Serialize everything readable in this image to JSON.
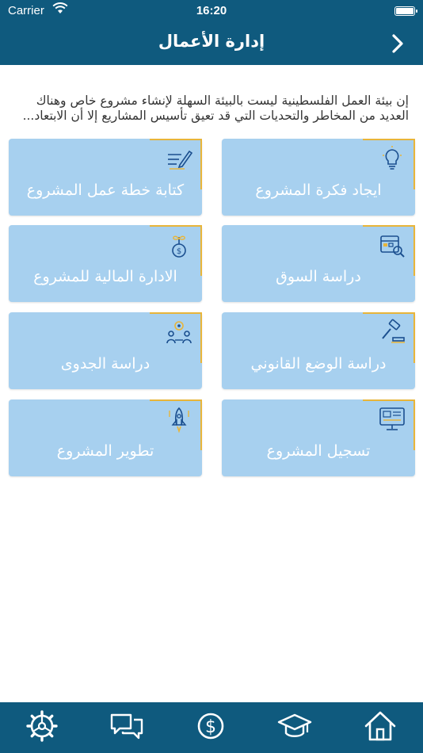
{
  "status_bar": {
    "carrier": "Carrier",
    "time": "16:20",
    "wifi_icon": "wifi-icon",
    "battery_icon": "battery-icon"
  },
  "nav": {
    "title": "إدارة الأعمال",
    "back_icon": "chevron-right-icon"
  },
  "intro_text": "إن بيئة العمل الفلسطينية ليست بالبيئة السهلة لإنشاء مشروع خاص وهناك العديد من المخاطر والتحديات التي قد تعيق تأسيس المشاريع إلا أن الابتعاد...",
  "cards": [
    {
      "label": "ايجاد فكرة المشروع",
      "icon": "lightbulb-icon"
    },
    {
      "label": "كتابة خطة عمل المشروع",
      "icon": "writing-icon"
    },
    {
      "label": "دراسة السوق",
      "icon": "market-analysis-icon"
    },
    {
      "label": "الادارة المالية للمشروع",
      "icon": "money-plant-icon"
    },
    {
      "label": "دراسة الوضع القانوني",
      "icon": "gavel-icon"
    },
    {
      "label": "دراسة الجدوى",
      "icon": "feasibility-team-icon"
    },
    {
      "label": "تسجيل المشروع",
      "icon": "registration-monitor-icon"
    },
    {
      "label": "تطوير المشروع",
      "icon": "rocket-icon"
    }
  ],
  "tab_bar": [
    {
      "icon": "settings-icon"
    },
    {
      "icon": "chat-icon"
    },
    {
      "icon": "dollar-icon"
    },
    {
      "icon": "graduation-cap-icon"
    },
    {
      "icon": "home-icon"
    }
  ],
  "colors": {
    "primary": "#0f5a7e",
    "card": "#a7d0ef",
    "accent": "#e8b53a",
    "icon_stroke": "#1b4f8f"
  }
}
